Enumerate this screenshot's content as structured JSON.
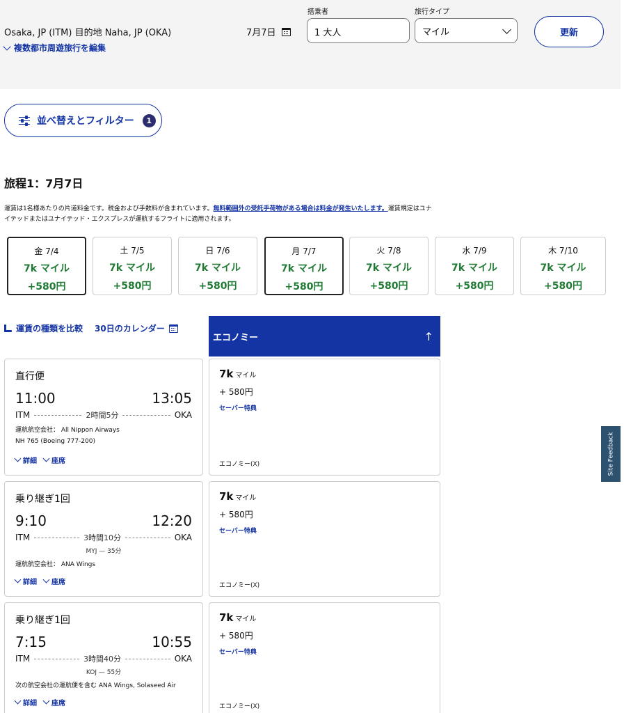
{
  "search": {
    "route": "Osaka, JP (ITM) 目的地 Naha, JP (OKA)",
    "edit_label": "複数都市周遊旅行を編集",
    "date": "7月7日",
    "passengers_label": "搭乗者",
    "passengers_value": "1 大人",
    "trip_type_label": "旅行タイプ",
    "trip_type_value": "マイル",
    "update_label": "更新"
  },
  "filter": {
    "label": "並べ替えとフィルター",
    "count": "1"
  },
  "itinerary": {
    "title": "旅程1：7月7日",
    "note_pre": "運賃は1名様あたりの片道料金です。税金および手数料が含まれています。",
    "note_link": "無料範囲外の受託手荷物がある場合は料金が発生いたします。",
    "note_post": "運賃規定はユナイテッドまたはユナイテッド・エクスプレスが運航するフライトに適用されます。"
  },
  "dates": [
    {
      "label": "金 7/4",
      "miles": "7k マイル",
      "price": "+580円",
      "selected": true
    },
    {
      "label": "土 7/5",
      "miles": "7k マイル",
      "price": "+580円",
      "selected": false
    },
    {
      "label": "日 7/6",
      "miles": "7k マイル",
      "price": "+580円",
      "selected": false
    },
    {
      "label": "月 7/7",
      "miles": "7k マイル",
      "price": "+580円",
      "selected": true
    },
    {
      "label": "火 7/8",
      "miles": "7k マイル",
      "price": "+580円",
      "selected": false
    },
    {
      "label": "水 7/9",
      "miles": "7k マイル",
      "price": "+580円",
      "selected": false
    },
    {
      "label": "木 7/10",
      "miles": "7k マイル",
      "price": "+580円",
      "selected": false
    }
  ],
  "links": {
    "compare": "運賃の種類を比較",
    "calendar": "30日のカレンダー"
  },
  "cabin_header": "エコノミー",
  "flights": [
    {
      "type": "直行便",
      "dep_time": "11:00",
      "arr_time": "13:05",
      "origin": "ITM",
      "destination": "OKA",
      "duration": "2時間5分",
      "stop": "",
      "airline": "運航航空会社： All Nippon Airways",
      "flight": "NH 765 (Boeing 777-200)",
      "details": "詳細",
      "seats": "座席",
      "fare": {
        "miles": "7k",
        "unit": "マイル",
        "plus": "+ 580円",
        "type": "セーバー特典",
        "class": "エコノミー(X)"
      }
    },
    {
      "type": "乗り継ぎ1回",
      "dep_time": "9:10",
      "arr_time": "12:20",
      "origin": "ITM",
      "destination": "OKA",
      "duration": "3時間10分",
      "stop": "MYJ — 35分",
      "airline": "運航航空会社： ANA Wings",
      "flight": "",
      "details": "詳細",
      "seats": "座席",
      "fare": {
        "miles": "7k",
        "unit": "マイル",
        "plus": "+ 580円",
        "type": "セーバー特典",
        "class": "エコノミー(X)"
      }
    },
    {
      "type": "乗り継ぎ1回",
      "dep_time": "7:15",
      "arr_time": "10:55",
      "origin": "ITM",
      "destination": "OKA",
      "duration": "3時間40分",
      "stop": "KOJ — 55分",
      "airline": "次の航空会社の運航便を含む ANA Wings, Solaseed Air",
      "flight": "",
      "details": "詳細",
      "seats": "座席",
      "fare": {
        "miles": "7k",
        "unit": "マイル",
        "plus": "+ 580円",
        "type": "セーバー特典",
        "class": "エコノミー(X)"
      }
    }
  ],
  "feedback": "Site Feedback"
}
